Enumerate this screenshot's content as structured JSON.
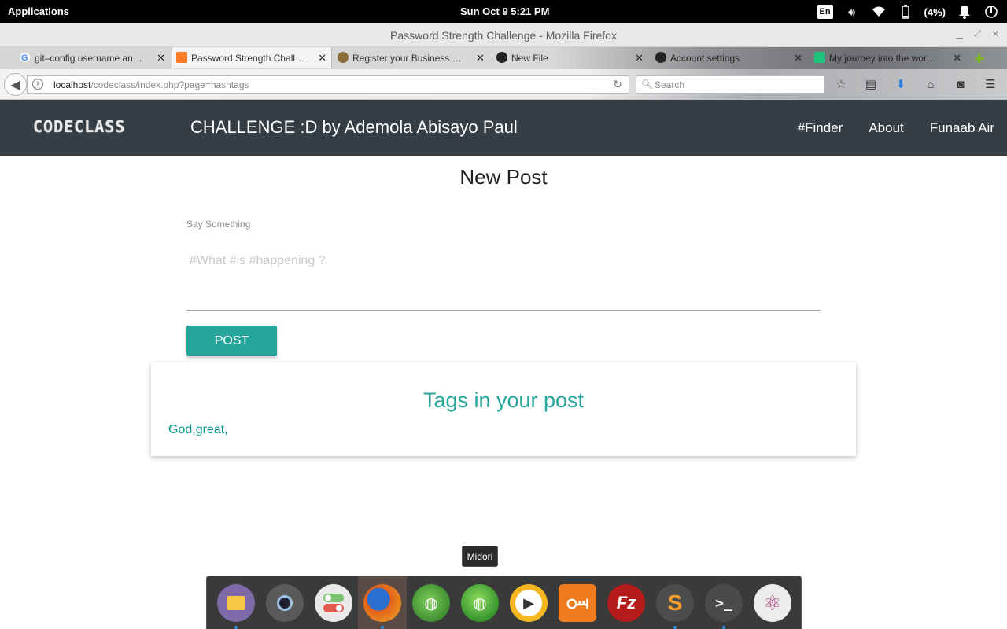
{
  "system_bar": {
    "applications": "Applications",
    "clock": "Sun Oct  9  5:21 PM",
    "lang": "En",
    "battery": "(4%)"
  },
  "window": {
    "title": "Password Strength Challenge - Mozilla Firefox"
  },
  "tabs": [
    {
      "label": "git–config username an…",
      "favicon_color": "#4285f4"
    },
    {
      "label": "Password Strength Chall…",
      "favicon_color": "#fb7a24"
    },
    {
      "label": "Register your Business …",
      "favicon_color": "#8a6d3b"
    },
    {
      "label": "New File",
      "favicon_color": "#222222"
    },
    {
      "label": "Account settings",
      "favicon_color": "#222222"
    },
    {
      "label": "My journey into the wor…",
      "favicon_color": "#1ec27a"
    }
  ],
  "address_bar": {
    "host": "localhost",
    "path": "/codeclass/index.php?page=hashtags",
    "search_placeholder": "Search"
  },
  "site": {
    "logo": "CODECLASS",
    "brand": "CHALLENGE :D by Ademola Abisayo Paul",
    "nav": [
      "#Finder",
      "About",
      "Funaab Air"
    ]
  },
  "form": {
    "title": "New Post",
    "label": "Say Something",
    "placeholder": "#What #is #happening ?",
    "button": "POST"
  },
  "tags_card": {
    "heading": "Tags in your post",
    "tags": "God,great,"
  },
  "dock": {
    "tooltip": "Midori",
    "apps": [
      {
        "name": "files",
        "color": "#7e6aa8"
      },
      {
        "name": "camera",
        "color": "#5a5a5a"
      },
      {
        "name": "tweaks",
        "color": "#e9e9e9"
      },
      {
        "name": "firefox",
        "color": "#e0611a"
      },
      {
        "name": "world-green",
        "color": "#4a9a3c"
      },
      {
        "name": "midori",
        "color": "#46a12f"
      },
      {
        "name": "media-player",
        "color": "#f5b720"
      },
      {
        "name": "xampp",
        "color": "#f07c1f"
      },
      {
        "name": "filezilla",
        "color": "#b51b1b"
      },
      {
        "name": "sublime",
        "color": "#4d4d4d"
      },
      {
        "name": "terminal",
        "color": "#4a4a4a"
      },
      {
        "name": "atom",
        "color": "#ececec"
      }
    ]
  }
}
